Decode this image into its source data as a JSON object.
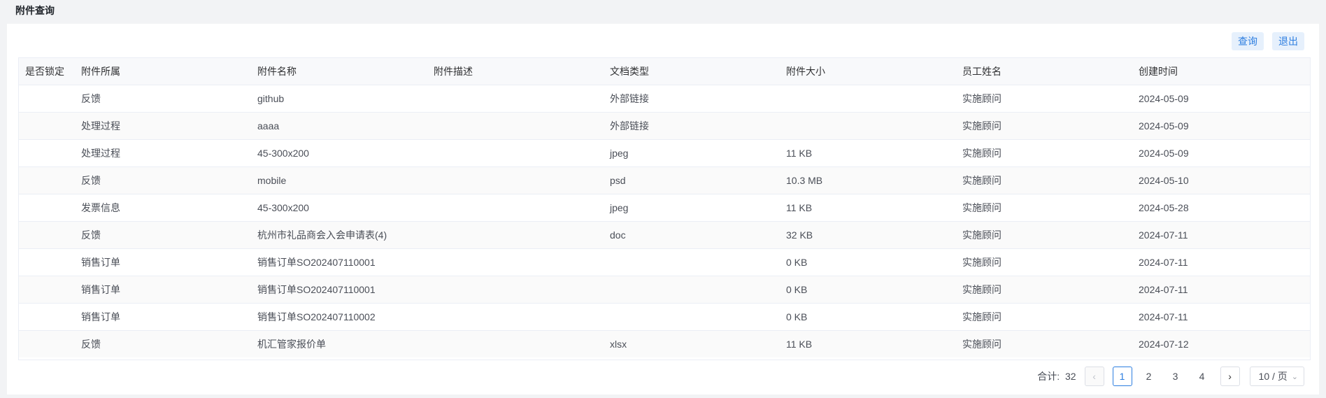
{
  "page": {
    "title": "附件查询"
  },
  "toolbar": {
    "query_label": "查询",
    "exit_label": "退出"
  },
  "table": {
    "columns": [
      "是否锁定",
      "附件所属",
      "附件名称",
      "附件描述",
      "文档类型",
      "附件大小",
      "员工姓名",
      "创建时间"
    ],
    "rows": [
      [
        "",
        "反馈",
        "github",
        "",
        "外部链接",
        "",
        "实施顾问",
        "2024-05-09"
      ],
      [
        "",
        "处理过程",
        "aaaa",
        "",
        "外部链接",
        "",
        "实施顾问",
        "2024-05-09"
      ],
      [
        "",
        "处理过程",
        "45-300x200",
        "",
        "jpeg",
        "11 KB",
        "实施顾问",
        "2024-05-09"
      ],
      [
        "",
        "反馈",
        "mobile",
        "",
        "psd",
        "10.3 MB",
        "实施顾问",
        "2024-05-10"
      ],
      [
        "",
        "发票信息",
        "45-300x200",
        "",
        "jpeg",
        "11 KB",
        "实施顾问",
        "2024-05-28"
      ],
      [
        "",
        "反馈",
        "杭州市礼品商会入会申请表(4)",
        "",
        "doc",
        "32 KB",
        "实施顾问",
        "2024-07-11"
      ],
      [
        "",
        "销售订单",
        "销售订单SO202407110001",
        "",
        "",
        "0 KB",
        "实施顾问",
        "2024-07-11"
      ],
      [
        "",
        "销售订单",
        "销售订单SO202407110001",
        "",
        "",
        "0 KB",
        "实施顾问",
        "2024-07-11"
      ],
      [
        "",
        "销售订单",
        "销售订单SO202407110002",
        "",
        "",
        "0 KB",
        "实施顾问",
        "2024-07-11"
      ],
      [
        "",
        "反馈",
        "机汇管家报价单",
        "",
        "xlsx",
        "11 KB",
        "实施顾问",
        "2024-07-12"
      ]
    ]
  },
  "pagination": {
    "total_label": "合计:",
    "total": "32",
    "pages": [
      "1",
      "2",
      "3",
      "4"
    ],
    "current": "1",
    "prev_icon": "‹",
    "next_icon": "›",
    "page_size": "10 / 页"
  }
}
